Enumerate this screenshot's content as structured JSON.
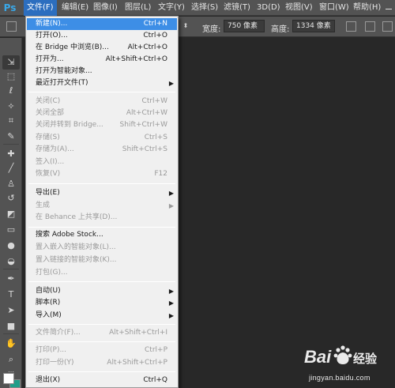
{
  "app": {
    "logo": "Ps"
  },
  "menubar": {
    "items": [
      {
        "label": "文件(F)"
      },
      {
        "label": "编辑(E)"
      },
      {
        "label": "图像(I)"
      },
      {
        "label": "图层(L)"
      },
      {
        "label": "文字(Y)"
      },
      {
        "label": "选择(S)"
      },
      {
        "label": "滤镜(T)"
      },
      {
        "label": "3D(D)"
      },
      {
        "label": "视图(V)"
      },
      {
        "label": "窗口(W)"
      },
      {
        "label": "帮助(H)"
      }
    ]
  },
  "options": {
    "width_label": "宽度:",
    "width_value": "750 像素",
    "height_label": "高度:",
    "height_value": "1334 像素"
  },
  "file_menu": {
    "items": [
      {
        "label": "新建(N)...",
        "shortcut": "Ctrl+N"
      },
      {
        "label": "打开(O)...",
        "shortcut": "Ctrl+O"
      },
      {
        "label": "在 Bridge 中浏览(B)...",
        "shortcut": "Alt+Ctrl+O"
      },
      {
        "label": "打开为...",
        "shortcut": "Alt+Shift+Ctrl+O"
      },
      {
        "label": "打开为智能对象...",
        "shortcut": ""
      },
      {
        "label": "最近打开文件(T)",
        "shortcut": ""
      },
      {
        "label": "关闭(C)",
        "shortcut": "Ctrl+W"
      },
      {
        "label": "关闭全部",
        "shortcut": "Alt+Ctrl+W"
      },
      {
        "label": "关闭并转到 Bridge...",
        "shortcut": "Shift+Ctrl+W"
      },
      {
        "label": "存储(S)",
        "shortcut": "Ctrl+S"
      },
      {
        "label": "存储为(A)...",
        "shortcut": "Shift+Ctrl+S"
      },
      {
        "label": "签入(I)...",
        "shortcut": ""
      },
      {
        "label": "恢复(V)",
        "shortcut": "F12"
      },
      {
        "label": "导出(E)",
        "shortcut": ""
      },
      {
        "label": "生成",
        "shortcut": ""
      },
      {
        "label": "在 Behance 上共享(D)...",
        "shortcut": ""
      },
      {
        "label": "搜索 Adobe Stock...",
        "shortcut": ""
      },
      {
        "label": "置入嵌入的智能对象(L)...",
        "shortcut": ""
      },
      {
        "label": "置入链接的智能对象(K)...",
        "shortcut": ""
      },
      {
        "label": "打包(G)...",
        "shortcut": ""
      },
      {
        "label": "自动(U)",
        "shortcut": ""
      },
      {
        "label": "脚本(R)",
        "shortcut": ""
      },
      {
        "label": "导入(M)",
        "shortcut": ""
      },
      {
        "label": "文件简介(F)...",
        "shortcut": "Alt+Shift+Ctrl+I"
      },
      {
        "label": "打印(P)...",
        "shortcut": "Ctrl+P"
      },
      {
        "label": "打印一份(Y)",
        "shortcut": "Alt+Shift+Ctrl+P"
      },
      {
        "label": "退出(X)",
        "shortcut": "Ctrl+Q"
      }
    ]
  },
  "watermark": {
    "brand": "Baidu经验",
    "url": "jingyan.baidu.com"
  },
  "colors": {
    "menu_highlight": "#3d8ee6",
    "active_menu": "#2c6ebf",
    "foreground_swatch": "#ffffff",
    "background_swatch": "#1f9e8a"
  }
}
